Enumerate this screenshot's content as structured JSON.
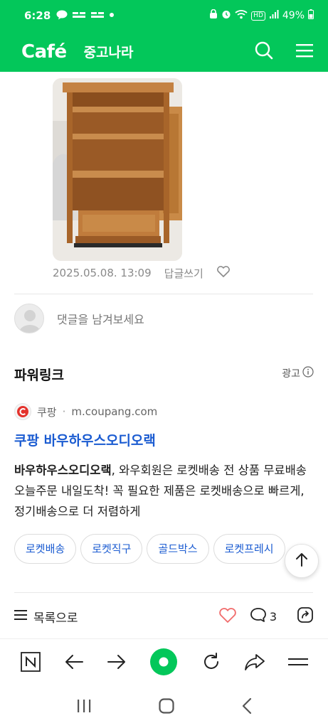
{
  "status": {
    "time": "6:28",
    "battery": "49%",
    "icons": [
      "talk-icon",
      "notification-icon",
      "notification-icon",
      "dot-icon",
      "lock-icon",
      "alarm-icon",
      "wifi-icon",
      "hd-icon",
      "signal-icon",
      "battery-icon"
    ],
    "hd": "HD"
  },
  "header": {
    "logo": "Café",
    "cafe_name": "중고나라",
    "icons": [
      "search-icon",
      "menu-icon"
    ],
    "color": "#03c75a"
  },
  "post": {
    "date": "2025.05.08. 13:09",
    "reply_label": "답글쓰기",
    "like_icon": "heart-outline-icon"
  },
  "comment": {
    "placeholder": "댓글을 남겨보세요"
  },
  "powerlink": {
    "title": "파워링크",
    "ad_label": "광고",
    "source_name": "쿠팡",
    "source_domain": "m.coupang.com",
    "headline": "쿠팡 바우하우스오디오랙",
    "desc_bold": "바우하우스오디오랙",
    "desc_rest": ", 와우회원은 로켓배송 전 상품 무료배송 오늘주문 내일도착! 꼭 필요한 제품은 로켓배송으로 빠르게, 정기배송으로 더 저렴하게",
    "chips": [
      "로켓배송",
      "로켓직구",
      "골드박스",
      "로켓프레시"
    ],
    "link_color": "#1a5bd1"
  },
  "post_bar": {
    "list_label": "목록으로",
    "comment_count": "3",
    "icons": [
      "hamburger-icon",
      "heart-icon",
      "comment-icon",
      "share-icon"
    ]
  },
  "browser_bar": {
    "icons": [
      "naver-n-icon",
      "back-arrow-icon",
      "forward-arrow-icon",
      "home-dot-icon",
      "refresh-icon",
      "share-arrow-icon",
      "more-menu-icon"
    ]
  },
  "system_nav": {
    "icons": [
      "recents-icon",
      "home-icon",
      "back-icon"
    ]
  }
}
